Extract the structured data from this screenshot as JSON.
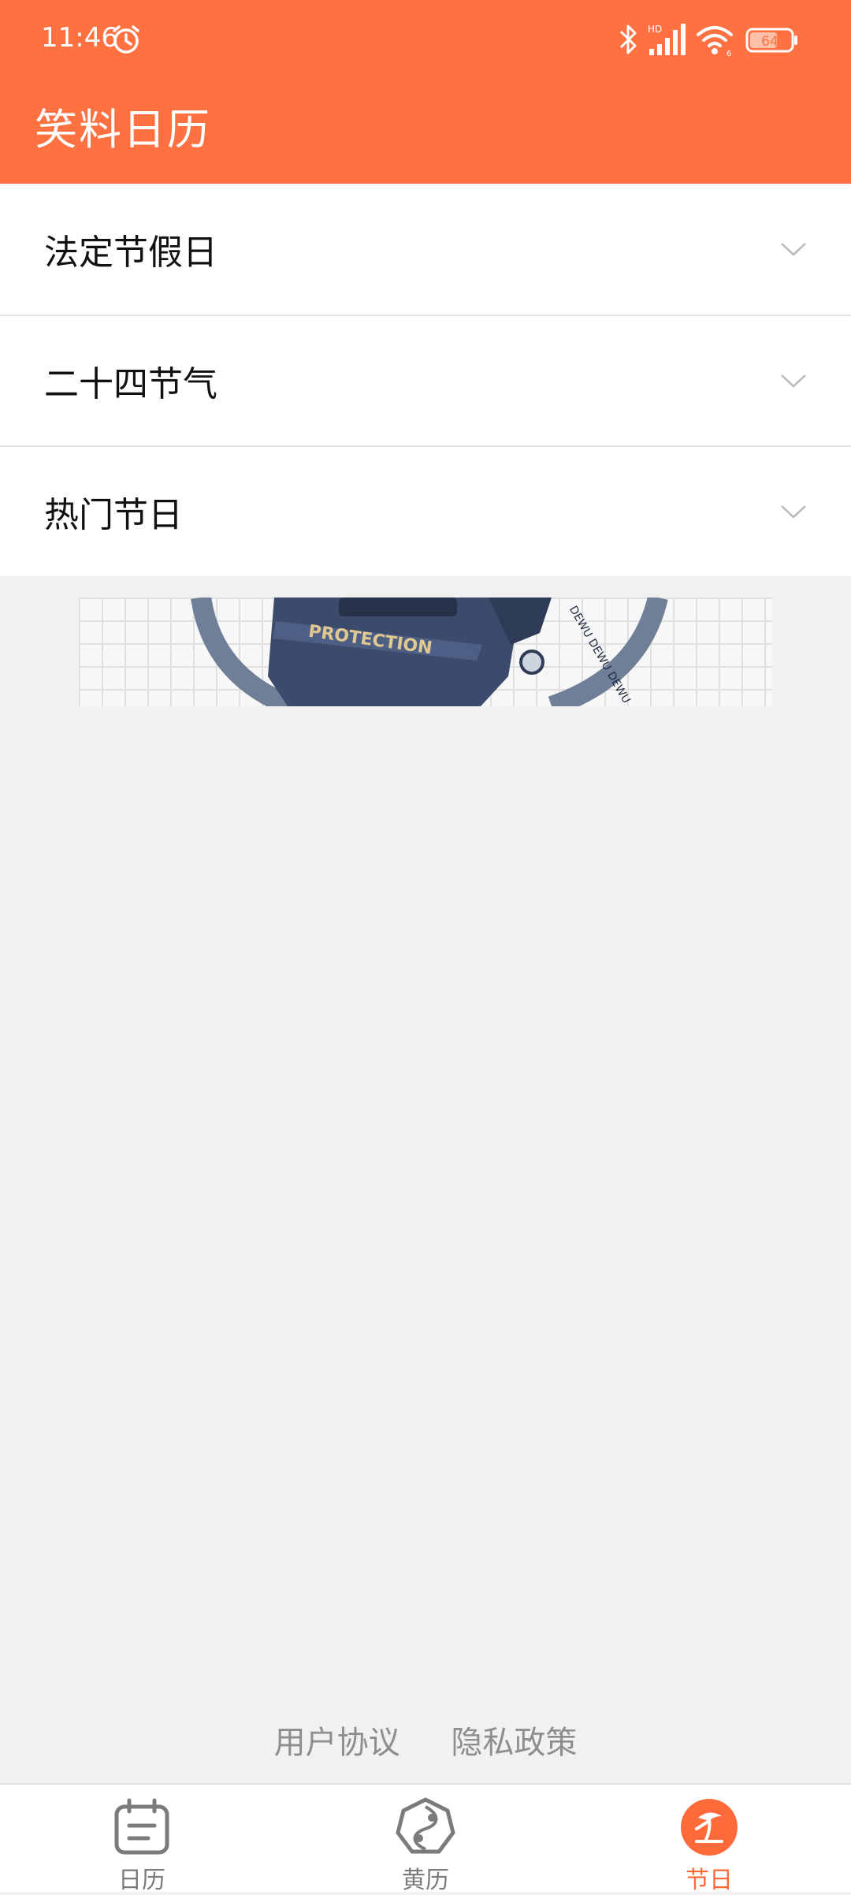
{
  "status_bar": {
    "time": "11:46",
    "battery": "64",
    "network": "HD",
    "sim_slot": "6"
  },
  "app": {
    "title": "笑料日历",
    "accent_color": "#ff7141"
  },
  "list": {
    "items": [
      {
        "label": "法定节假日"
      },
      {
        "label": "二十四节气"
      },
      {
        "label": "热门节日"
      }
    ]
  },
  "banner": {
    "text_protection": "PROTECTION",
    "text_ring": "DEWU DEWU DEWU"
  },
  "footer": {
    "user_agreement": "用户协议",
    "privacy_policy": "隐私政策"
  },
  "bottom_nav": {
    "items": [
      {
        "label": "日历",
        "icon": "calendar-icon"
      },
      {
        "label": "黄历",
        "icon": "yinyang-icon"
      },
      {
        "label": "节日",
        "icon": "beach-icon",
        "active": true
      }
    ]
  }
}
